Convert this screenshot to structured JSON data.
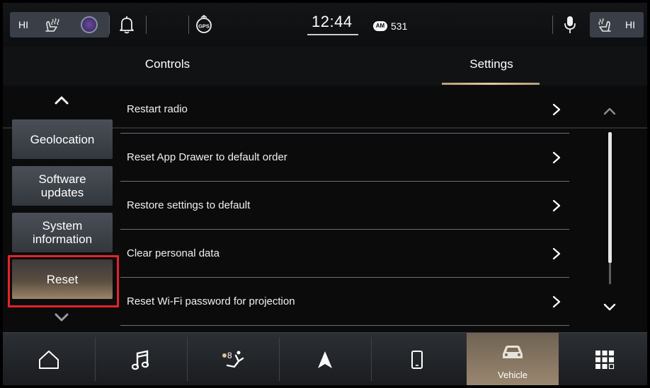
{
  "status_bar": {
    "hi_left": "HI",
    "hi_right": "HI",
    "time": "12:44",
    "radio_badge": "AM",
    "station": "531",
    "gps_label": "GPS"
  },
  "tabs": [
    {
      "label": "Controls",
      "active": false
    },
    {
      "label": "Settings",
      "active": true
    }
  ],
  "left_menu": {
    "items": [
      {
        "label": "Geolocation",
        "active": false
      },
      {
        "label": "Software\nupdates",
        "active": false
      },
      {
        "label": "System\ninformation",
        "active": false
      },
      {
        "label": "Reset",
        "active": true
      }
    ]
  },
  "settings_list": [
    {
      "label": "Restart radio"
    },
    {
      "label": "Reset App Drawer to default order"
    },
    {
      "label": "Restore settings to default"
    },
    {
      "label": "Clear personal data"
    },
    {
      "label": "Reset Wi-Fi password for projection"
    }
  ],
  "bottom_nav": {
    "items": [
      {
        "icon": "home-icon"
      },
      {
        "icon": "music-icon"
      },
      {
        "icon": "climate-icon",
        "fan_level": "8"
      },
      {
        "icon": "navigation-icon"
      },
      {
        "icon": "phone-icon"
      },
      {
        "icon": "vehicle-icon",
        "label": "Vehicle",
        "active": true
      },
      {
        "icon": "apps-grid-icon"
      }
    ]
  },
  "colors": {
    "accent_gold": "#d9bf98",
    "highlight_outline": "#e3242b",
    "button_gray": "#3a3f47"
  }
}
